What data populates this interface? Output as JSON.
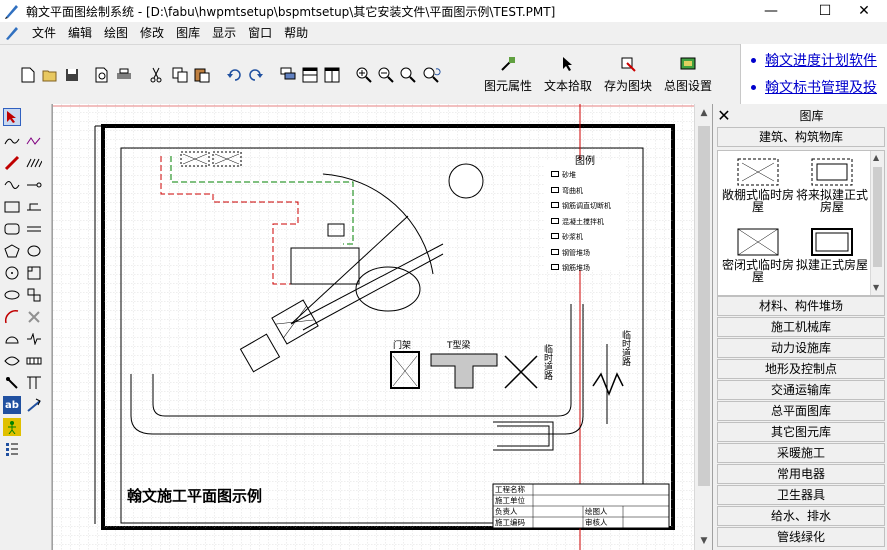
{
  "window": {
    "title": "翰文平面图绘制系统 - [D:\\fabu\\hwpmtsetup\\bspmtsetup\\其它安装文件\\平面图示例\\TEST.PMT]",
    "minimize": "—",
    "maximize": "☐",
    "close": "✕"
  },
  "menu": [
    "文件",
    "编辑",
    "绘图",
    "修改",
    "图库",
    "显示",
    "窗口",
    "帮助"
  ],
  "toolbar": {
    "buttons": [
      "new-icon",
      "open-icon",
      "save-icon",
      "print-preview-icon",
      "print-icon",
      "cut-icon",
      "copy-icon",
      "paste-icon",
      "undo-icon",
      "redo-icon",
      "layer-icon",
      "split-h-icon",
      "split-v-icon",
      "zoom-in-icon",
      "zoom-out-icon",
      "zoom-window-icon",
      "zoom-refresh-icon"
    ],
    "big": [
      "图元属性",
      "文本拾取",
      "存为图块",
      "总图设置"
    ]
  },
  "ads": [
    "翰文进度计划软件",
    "翰文标书管理及投"
  ],
  "drawing": {
    "legend_title": "图例",
    "legend_items": [
      "砂堆",
      "弯曲机",
      "钢筋调直切断机",
      "混凝土搅拌机",
      "砂浆机",
      "钢管堆场",
      "钢筋堆场"
    ],
    "labels": {
      "gate": "门架",
      "tbeam": "T型梁",
      "road1": "临时道路",
      "road2": "临时道路"
    },
    "caption": "翰文施工平面图示例",
    "titleblock": [
      "工程名称",
      "施工单位",
      "负责人",
      "绘图人",
      "施工编码",
      "审核人"
    ]
  },
  "panel": {
    "header": "图库",
    "close": "✕",
    "top_category": "建筑、构筑物库",
    "items": [
      {
        "label": "敞棚式临时房屋"
      },
      {
        "label": "将来拟建正式房屋"
      },
      {
        "label": "密闭式临时房屋"
      },
      {
        "label": "拟建正式房屋"
      }
    ],
    "categories": [
      "材料、构件堆场",
      "施工机械库",
      "动力设施库",
      "地形及控制点",
      "交通运输库",
      "总平面图库",
      "其它图元库",
      "采暖施工",
      "常用电器",
      "卫生器具",
      "给水、排水",
      "管线绿化"
    ]
  },
  "colors": {
    "accent_red": "#cc0000",
    "green_line": "#008000",
    "link_blue": "#0000cc"
  }
}
